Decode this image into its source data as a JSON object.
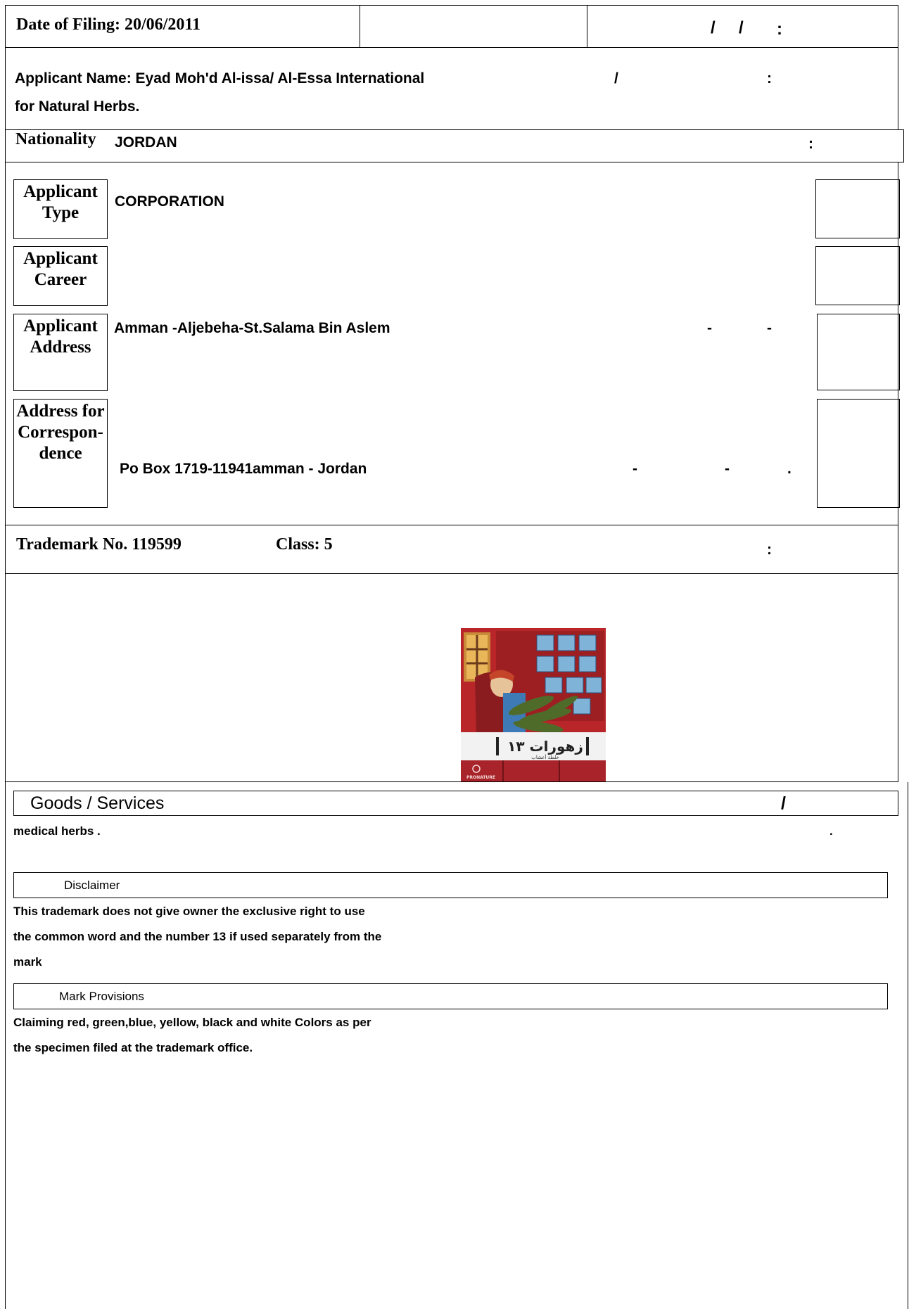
{
  "filing": {
    "label": "Date of Filing:",
    "date": "20/06/2011",
    "arabic_slashes": "/     /",
    "arabic_colon": ":"
  },
  "applicant": {
    "name_label": "Applicant Name:",
    "name_line1": "Eyad Moh'd Al-issa/ Al-Essa International",
    "name_line2": "for Natural Herbs.",
    "arabic_slash": "/",
    "arabic_colon": ":"
  },
  "nationality": {
    "label": "Nationality",
    "value": "JORDAN",
    "arabic_colon": ":"
  },
  "applicant_type": {
    "label_line1": "Applicant",
    "label_line2": "Type",
    "value": "CORPORATION"
  },
  "applicant_career": {
    "label_line1": "Applicant",
    "label_line2": "Career",
    "value": ""
  },
  "applicant_address": {
    "label_line1": "Applicant",
    "label_line2": "Address",
    "value": "Amman -Aljebeha-St.Salama Bin Aslem",
    "arabic_marks": [
      "-",
      "-"
    ]
  },
  "correspondence": {
    "label_line1": "Address for",
    "label_line2": "Correspon-",
    "label_line3": "dence",
    "value": "Po Box 1719-11941amman - Jordan",
    "arabic_marks": [
      "-",
      "-",
      "."
    ]
  },
  "trademark": {
    "number_label": "Trademark No.",
    "number": "119599",
    "class_label": "Class:",
    "class_value": "5",
    "arabic_colon": ":"
  },
  "mark_image": {
    "arabic_text": "زهورات ١٣",
    "arabic_subtext": "خلطة أعشاب",
    "brand_text": "PRONATURE"
  },
  "goods": {
    "header": "Goods / Services",
    "header_arabic_slash": "/",
    "value": "medical herbs .",
    "arabic_mark": "."
  },
  "disclaimer": {
    "header": "Disclaimer",
    "lines": [
      "This trademark does not give owner the exclusive right to use",
      "the common word and the number 13 if used separately from the",
      "mark"
    ]
  },
  "mark_provisions": {
    "header": "Mark Provisions",
    "lines": [
      "Claiming red, green,blue, yellow, black and white Colors as per",
      "the specimen filed at the trademark office."
    ]
  }
}
